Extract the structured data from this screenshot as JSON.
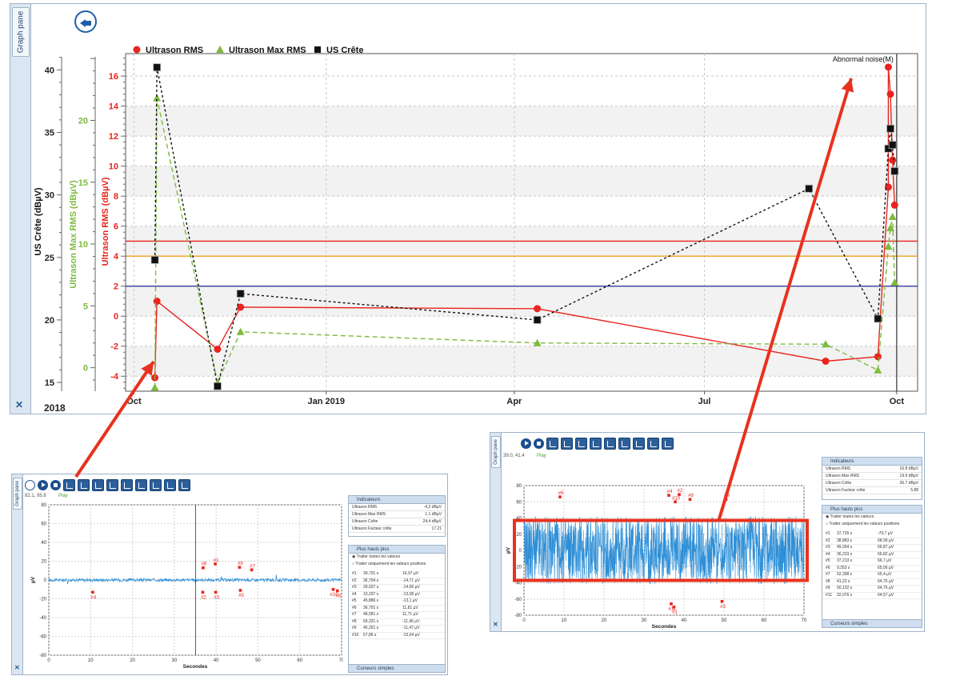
{
  "main": {
    "tab_label": "Graph pane",
    "year": "2018",
    "legend": [
      {
        "label": "Ultrason RMS",
        "color": "#e8251f",
        "marker": "circle"
      },
      {
        "label": "Ultrason Max RMS",
        "color": "#7dbb3e",
        "marker": "triangle"
      },
      {
        "label": "US Crête",
        "color": "#111111",
        "marker": "square"
      }
    ],
    "event_label": "Abnormal noise(M)"
  },
  "chart_data": [
    {
      "type": "line",
      "x_type": "date",
      "x_ticks": [
        {
          "date": "2018-10-01",
          "label": "Oct"
        },
        {
          "date": "2019-01-01",
          "label": "Jan 2019"
        },
        {
          "date": "2019-04-01",
          "label": "Apr"
        },
        {
          "date": "2019-07-01",
          "label": "Jul"
        },
        {
          "date": "2019-10-01",
          "label": "Oct"
        }
      ],
      "xlim": [
        "2018-09-27",
        "2019-10-11"
      ],
      "axes": [
        {
          "id": "rms",
          "label": "Ultrason RMS (dBµV)",
          "color": "#e8251f",
          "ylim": [
            -5,
            17.5
          ],
          "ticks": [
            -4,
            -2,
            0,
            2,
            4,
            6,
            8,
            10,
            12,
            14,
            16
          ]
        },
        {
          "id": "max",
          "label": "Ultrason Max RMS (dBµV)",
          "color": "#7dbb3e",
          "ylim": [
            -1.9,
            25.4
          ],
          "ticks": [
            0,
            5,
            10,
            15,
            20
          ]
        },
        {
          "id": "crete",
          "label": "US Crête (dBµV)",
          "color": "#111111",
          "ylim": [
            14.3,
            41.3
          ],
          "ticks": [
            15,
            20,
            25,
            30,
            35,
            40
          ]
        }
      ],
      "reference_lines": [
        {
          "axis": "rms",
          "value": 5,
          "color": "#e8251f"
        },
        {
          "axis": "rms",
          "value": 4,
          "color": "#f0a020"
        },
        {
          "axis": "rms",
          "value": 2,
          "color": "#3a3aa0"
        }
      ],
      "event_markers": [
        {
          "date": "2019-10-01",
          "label": "Abnormal noise(M)"
        }
      ],
      "series": [
        {
          "name": "Ultrason RMS",
          "axis": "rms",
          "color": "#e8251f",
          "marker": "circle",
          "dash": "",
          "points": [
            [
              "2018-10-11",
              -4.1
            ],
            [
              "2018-10-12",
              1.0
            ],
            [
              "2018-11-10",
              -2.2
            ],
            [
              "2018-11-21",
              0.6
            ],
            [
              "2019-04-12",
              0.5
            ],
            [
              "2019-08-28",
              -3.0
            ],
            [
              "2019-09-22",
              -2.7
            ],
            [
              "2019-09-27",
              8.6
            ],
            [
              "2019-09-27",
              16.6
            ],
            [
              "2019-09-28",
              14.8
            ],
            [
              "2019-09-29",
              10.4
            ],
            [
              "2019-09-30",
              7.4
            ]
          ]
        },
        {
          "name": "Ultrason Max RMS",
          "axis": "max",
          "color": "#7dbb3e",
          "marker": "triangle",
          "dash": "6,4",
          "points": [
            [
              "2018-10-11",
              -1.6
            ],
            [
              "2018-10-12",
              21.8
            ],
            [
              "2018-11-10",
              -1.2
            ],
            [
              "2018-11-21",
              2.9
            ],
            [
              "2019-04-12",
              2.0
            ],
            [
              "2019-08-28",
              1.9
            ],
            [
              "2019-09-22",
              -0.2
            ],
            [
              "2019-09-27",
              9.8
            ],
            [
              "2019-09-28",
              11.3
            ],
            [
              "2019-09-29",
              12.2
            ],
            [
              "2019-09-30",
              6.9
            ]
          ]
        },
        {
          "name": "US Crête",
          "axis": "crete",
          "color": "#111111",
          "marker": "square",
          "dash": "3,3",
          "points": [
            [
              "2018-10-11",
              24.8
            ],
            [
              "2018-10-12",
              40.2
            ],
            [
              "2018-11-10",
              14.7
            ],
            [
              "2018-11-21",
              22.1
            ],
            [
              "2019-04-12",
              20.0
            ],
            [
              "2019-08-20",
              30.5
            ],
            [
              "2019-09-22",
              20.1
            ],
            [
              "2019-09-27",
              33.7
            ],
            [
              "2019-09-28",
              35.3
            ],
            [
              "2019-09-29",
              34.0
            ],
            [
              "2019-09-30",
              31.9
            ]
          ]
        }
      ]
    },
    {
      "type": "line",
      "xlabel": "Secondes",
      "ylabel": "µV",
      "xlim": [
        0,
        70
      ],
      "ylim": [
        -80,
        80
      ],
      "x_ticks": [
        0,
        10,
        20,
        30,
        40,
        50,
        60,
        70
      ],
      "y_ticks": [
        -80,
        -60,
        -40,
        -20,
        0,
        20,
        40,
        60,
        80
      ],
      "cursor_x": 35.1,
      "peaks": [
        {
          "label": "#1",
          "x": 39.8,
          "y": 17.1
        },
        {
          "label": "#2",
          "x": 36.8,
          "y": -13.0
        },
        {
          "label": "#3",
          "x": 39.9,
          "y": -13.0
        },
        {
          "label": "#4",
          "x": 10.5,
          "y": -13.0
        },
        {
          "label": "#5",
          "x": 45.8,
          "y": -11.0
        },
        {
          "label": "#6",
          "x": 36.9,
          "y": 13.0
        },
        {
          "label": "#7",
          "x": 48.5,
          "y": 10.8
        },
        {
          "label": "#8",
          "x": 69.0,
          "y": -11.5
        },
        {
          "label": "#9",
          "x": 45.6,
          "y": 13.5
        },
        {
          "label": "#10",
          "x": 68.0,
          "y": -10.0
        }
      ]
    },
    {
      "type": "line",
      "xlabel": "Secondes",
      "ylabel": "µV",
      "xlim": [
        0,
        70
      ],
      "ylim": [
        -80,
        80
      ],
      "x_ticks": [
        0,
        10,
        20,
        30,
        40,
        50,
        60,
        70
      ],
      "y_ticks": [
        -80,
        -60,
        -40,
        -20,
        0,
        20,
        40,
        60,
        80
      ],
      "peaks": [
        {
          "label": "#1",
          "x": 37.5,
          "y": -70
        },
        {
          "label": "#2",
          "x": 38.8,
          "y": 69
        },
        {
          "label": "#3",
          "x": 49.5,
          "y": -63
        },
        {
          "label": "#4",
          "x": 36.2,
          "y": 68
        },
        {
          "label": "#6",
          "x": 9.0,
          "y": 66
        },
        {
          "label": "#8",
          "x": 41.5,
          "y": 63
        },
        {
          "label": "#9",
          "x": 50.5,
          "y": 63
        },
        {
          "label": "#10",
          "x": 37.8,
          "y": 60
        },
        {
          "label": "#11",
          "x": 36.8,
          "y": -66
        }
      ]
    }
  ],
  "thumb_left": {
    "tab_label": "Graph pane",
    "coords": "82.1, 95.8",
    "status": "Play",
    "indicators_title": "Indicateurs",
    "indicators": [
      {
        "name": "Ultrason RMS",
        "value": "-4,2 dBµV"
      },
      {
        "name": "Ultrason Max RMS",
        "value": "1.1 dBµV"
      },
      {
        "name": "Ultrason Crête",
        "value": "24,4 dBµV"
      },
      {
        "name": "Ultrason Facteur crête",
        "value": "17.21"
      }
    ],
    "peaks_title": "Plus hauts pics",
    "option_all": "Traiter toutes les valeurs",
    "option_pos": "Traiter uniquement les valeurs positives",
    "peaks": [
      [
        "#1",
        "39,791 s",
        "16,97 µV"
      ],
      [
        "#2",
        "36,794 s",
        "-14,71 µV"
      ],
      [
        "#3",
        "39,937 s",
        "-14,06 µV"
      ],
      [
        "#4",
        "10,297 s",
        "-13,08 µV"
      ],
      [
        "#5",
        "45,886 s",
        "-13,1 µV"
      ],
      [
        "#6",
        "36,791 s",
        "11,81 µV"
      ],
      [
        "#7",
        "48,581 s",
        "11,71 µV"
      ],
      [
        "#8",
        "69,331 s",
        "-11,46 µV"
      ],
      [
        "#9",
        "45,261 s",
        "-11,47 µV"
      ],
      [
        "#10",
        "67,86 s",
        "-10,04 µV"
      ]
    ],
    "cursors_title": "Curseurs simples"
  },
  "thumb_right": {
    "tab_label": "Graph pane",
    "coords": "39.0, 41.4",
    "status": "Play",
    "indicators_title": "Indicateurs",
    "indicators": [
      {
        "name": "Ultrason RMS",
        "value": "16.8 dBµV"
      },
      {
        "name": "Ultrason Max RMS",
        "value": "19.9 dBµV"
      },
      {
        "name": "Ultrason Crête",
        "value": "36.7 dBµV"
      },
      {
        "name": "Ultrason Facteur crête",
        "value": "5.88"
      }
    ],
    "peaks_title": "Plus hauts pics",
    "option_all": "Traiter toutes les valeurs",
    "option_pos": "Traiter uniquement les valeurs positives",
    "peaks": [
      [
        "#1",
        "37,726 s",
        "-70,7 µV"
      ],
      [
        "#2",
        "38,883 s",
        "68,99 µV"
      ],
      [
        "#3",
        "49,264 s",
        "66,87 µV"
      ],
      [
        "#4",
        "36,233 s",
        "66,82 µV"
      ],
      [
        "#5",
        "37,213 s",
        "66,7 µV"
      ],
      [
        "#6",
        "9,353 s",
        "65,56 µV"
      ],
      [
        "#7",
        "52,398 s",
        "65,4 µV"
      ],
      [
        "#8",
        "41,23 s",
        "64,76 µV"
      ],
      [
        "#9",
        "50,132 s",
        "64,76 µV"
      ],
      [
        "#11",
        "32,076 s",
        "64,57 µV"
      ]
    ],
    "cursors_title": "Curseurs simples"
  },
  "colors": {
    "accent": "#1f5fa8",
    "arrow": "#e8321f",
    "signal": "#2f8fd6",
    "highlight": "#e8321f"
  }
}
